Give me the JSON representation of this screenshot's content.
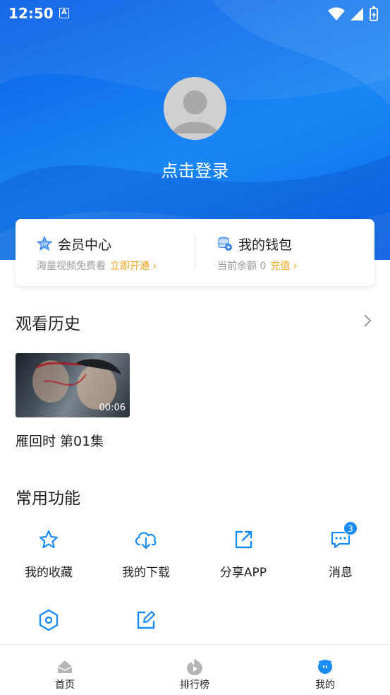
{
  "status_bar": {
    "time": "12:50",
    "notification_icon": "A"
  },
  "profile": {
    "login_text": "点击登录",
    "avatar_icon": "default-avatar-icon"
  },
  "member_card": {
    "vip": {
      "title": "会员中心",
      "subtitle": "海量视频免费看",
      "action": "立即开通 ›"
    },
    "wallet": {
      "title": "我的钱包",
      "subtitle": "当前余额 0",
      "action": "充值 ›"
    }
  },
  "history": {
    "title": "观看历史",
    "items": [
      {
        "title": "雁回时 第01集",
        "duration": "00:06"
      }
    ]
  },
  "functions": {
    "title": "常用功能",
    "items": [
      {
        "label": "我的收藏",
        "icon": "star-icon"
      },
      {
        "label": "我的下载",
        "icon": "cloud-download-icon"
      },
      {
        "label": "分享APP",
        "icon": "share-icon"
      },
      {
        "label": "消息",
        "icon": "message-icon",
        "badge": "3"
      },
      {
        "label": "",
        "icon": "settings-icon"
      },
      {
        "label": "",
        "icon": "edit-icon"
      }
    ]
  },
  "tabbar": {
    "items": [
      {
        "label": "首页",
        "icon": "home-icon"
      },
      {
        "label": "排行榜",
        "icon": "ranking-icon"
      },
      {
        "label": "我的",
        "icon": "profile-icon",
        "active": true
      }
    ]
  },
  "colors": {
    "accent": "#1a8cf5",
    "highlight": "#f2a61c",
    "header_blue": "#0c6cee"
  }
}
